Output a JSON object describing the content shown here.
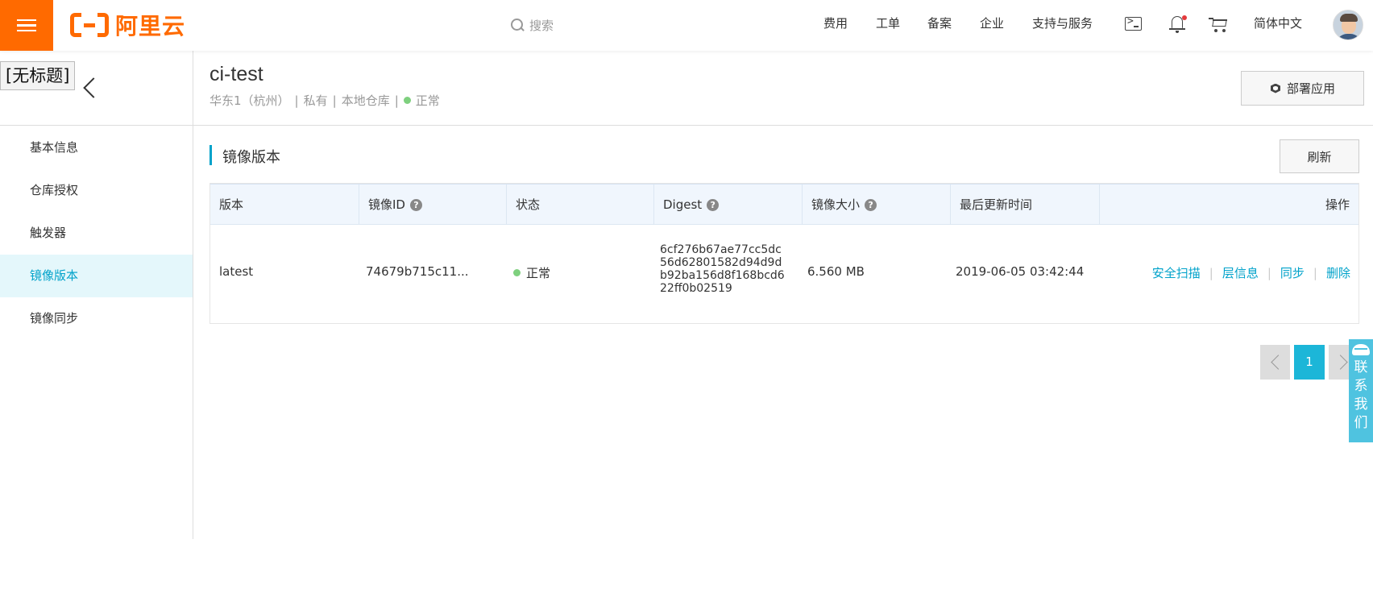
{
  "topbar": {
    "logo_text": "阿里云",
    "search_placeholder": "搜索",
    "nav": [
      "费用",
      "工单",
      "备案",
      "企业",
      "支持与服务"
    ],
    "language": "简体中文"
  },
  "sidebar": {
    "window_title": "[无标题]",
    "items": [
      {
        "label": "基本信息"
      },
      {
        "label": "仓库授权"
      },
      {
        "label": "触发器"
      },
      {
        "label": "镜像版本"
      },
      {
        "label": "镜像同步"
      }
    ]
  },
  "repo": {
    "name": "ci-test",
    "region": "华东1（杭州）",
    "visibility": "私有",
    "source": "本地仓库",
    "status": "正常",
    "deploy_label": "部署应用"
  },
  "section": {
    "title": "镜像版本",
    "refresh_label": "刷新"
  },
  "table": {
    "headers": [
      "版本",
      "镜像ID",
      "状态",
      "Digest",
      "镜像大小",
      "最后更新时间",
      "操作"
    ],
    "rows": [
      {
        "version": "latest",
        "image_id": "74679b715c11...",
        "status": "正常",
        "digest_lines": [
          "6cf276b67ae77cc5dc",
          "56d62801582d94d9d",
          "b92ba156d8f168bcd6",
          "22ff0b02519"
        ],
        "size": "6.560 MB",
        "updated": "2019-06-05 03:42:44",
        "actions": [
          "安全扫描",
          "层信息",
          "同步",
          "删除"
        ]
      }
    ]
  },
  "pagination": {
    "current": "1"
  },
  "contact": {
    "label": "联系我们"
  },
  "colors": {
    "brand": "#ff6a00",
    "accent": "#00a2ca",
    "status_ok": "#7ed07e",
    "page_active": "#1cb6d8"
  }
}
